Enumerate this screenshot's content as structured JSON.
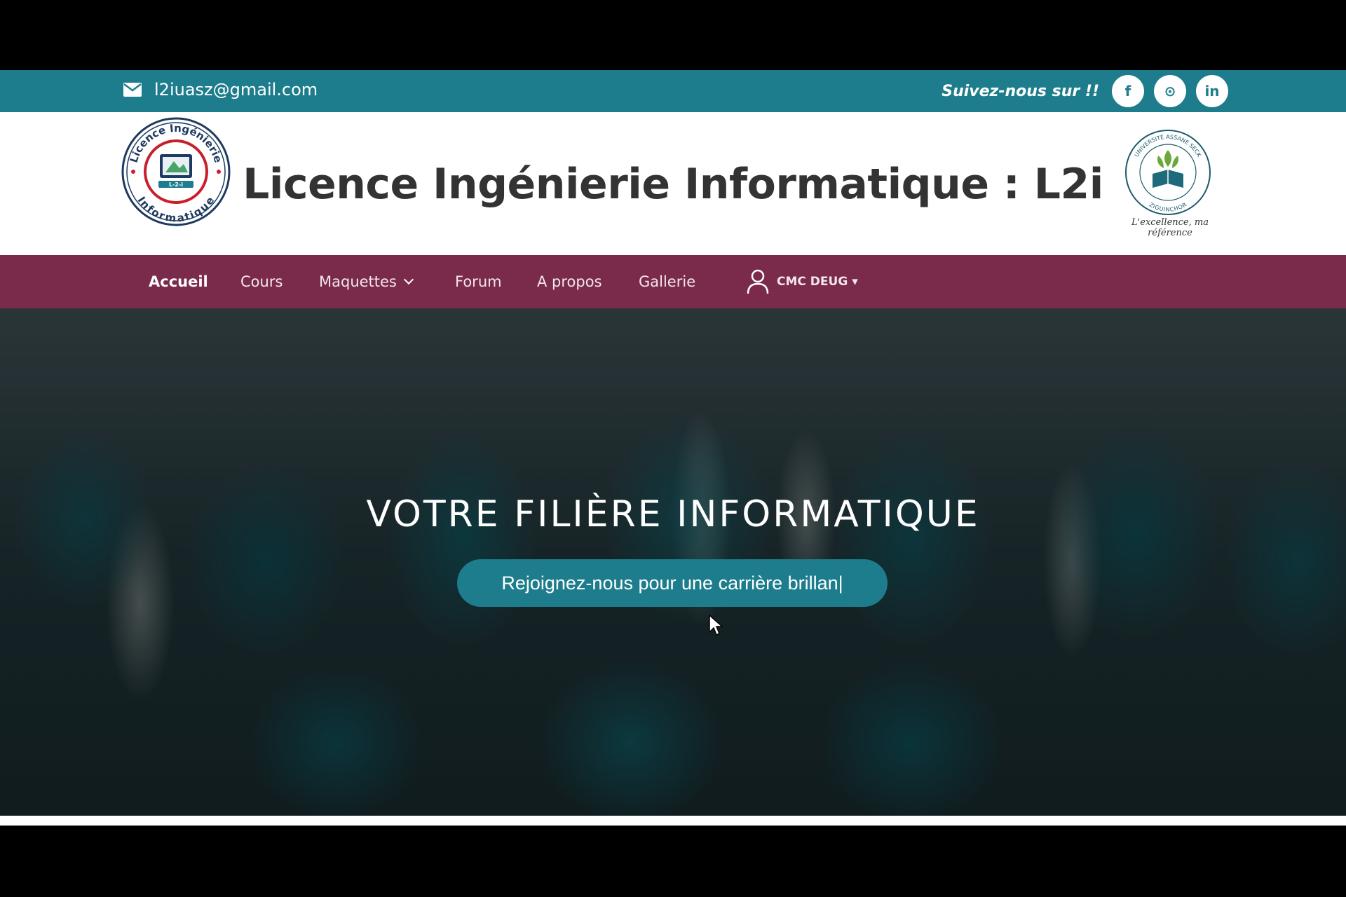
{
  "topbar": {
    "email": "l2iuasz@gmail.com",
    "follow_text": "Suivez-nous sur !!",
    "socials": [
      {
        "icon": "facebook-icon",
        "glyph": "f"
      },
      {
        "icon": "github-icon",
        "glyph": "⊙"
      },
      {
        "icon": "linkedin-icon",
        "glyph": "in"
      }
    ]
  },
  "header": {
    "title": "Licence Ingénierie Informatique : L2i",
    "logo_left_ring_top": "Licence Ingénierie",
    "logo_left_ring_bottom": "Informatique",
    "logo_left_badge": "L-2-i",
    "logo_right_ring_top": "UNIVERSITÉ ASSANE SECK",
    "logo_right_ring_bottom": "ZIGUINCHOR",
    "logo_right_tagline": "L'excellence, ma référence"
  },
  "nav": {
    "items": [
      {
        "label": "Accueil",
        "active": true
      },
      {
        "label": "Cours"
      },
      {
        "label": "Maquettes",
        "dropdown": true
      },
      {
        "label": "Forum"
      },
      {
        "label": "A propos"
      },
      {
        "label": "Gallerie"
      }
    ],
    "user": "CMC DEUG ▾"
  },
  "hero": {
    "title": "VOTRE FILIÈRE INFORMATIQUE",
    "button_label": "Rejoignez-nous pour une carrière brillan|"
  },
  "colors": {
    "teal": "#1d7d8c",
    "maroon": "#7a2a4a"
  }
}
